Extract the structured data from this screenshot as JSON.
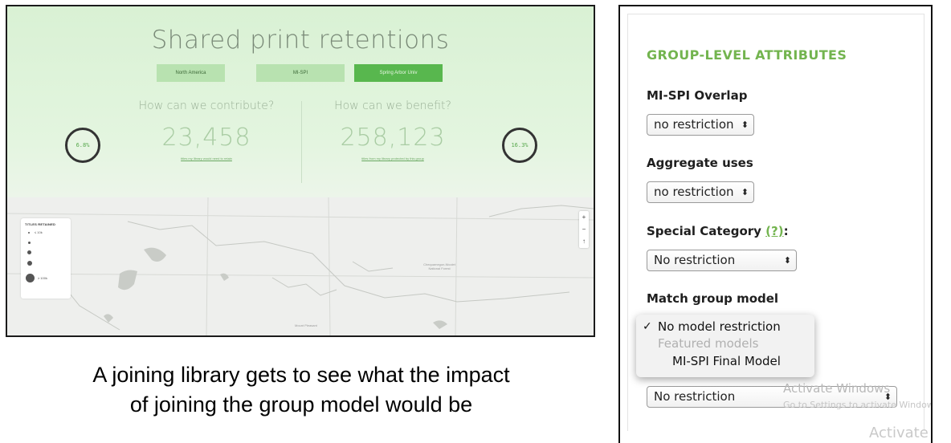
{
  "retention_panel": {
    "title": "Shared print retentions",
    "tabs": [
      {
        "label": "North America"
      },
      {
        "label": "MI-SPI"
      },
      {
        "label": "Spring Arbor Univ"
      }
    ],
    "contribute": {
      "question": "How can we contribute?",
      "value": "23,458",
      "link": "titles my library would need to retain",
      "percent": "6.8%"
    },
    "benefit": {
      "question": "How can we benefit?",
      "value": "258,123",
      "link": "titles from my library protected by this group",
      "percent": "16.3%"
    },
    "legend": {
      "title": "TITLES RETAINED",
      "min_label": "≤ 10k",
      "max_label": "≥ 100k"
    },
    "zoom": {
      "in": "+",
      "out": "−",
      "north": "↑"
    },
    "map_labels": [
      "Chequamegon-Nicolet National Forest",
      "Mount Pleasant"
    ]
  },
  "caption": {
    "line1": "A joining library gets to see what the impact",
    "line2": "of joining the group model would be"
  },
  "attributes_panel": {
    "heading": "GROUP-LEVEL ATTRIBUTES",
    "overlap": {
      "label": "MI-SPI Overlap",
      "value": "no restriction"
    },
    "aggregate": {
      "label": "Aggregate uses",
      "value": "no restriction"
    },
    "special": {
      "label": "Special Category",
      "help": "(?)",
      "colon": ":",
      "value": "No restriction"
    },
    "match": {
      "label": "Match group model",
      "options": [
        {
          "label": "No model restriction",
          "selected": true
        },
        {
          "label": "Featured models",
          "group_header": true
        },
        {
          "label": "MI-SPI Final Model",
          "selected": false
        }
      ],
      "check": "✓"
    },
    "final_select": {
      "value": "No restriction"
    },
    "select_arrow": "⬍",
    "watermark": {
      "title": "Activate Windows",
      "subtitle": "Go to Settings to activate Windows.",
      "ghost": "Activate"
    },
    "colors": {
      "accent": "#73b44f",
      "tab_active": "#58b74e"
    }
  }
}
